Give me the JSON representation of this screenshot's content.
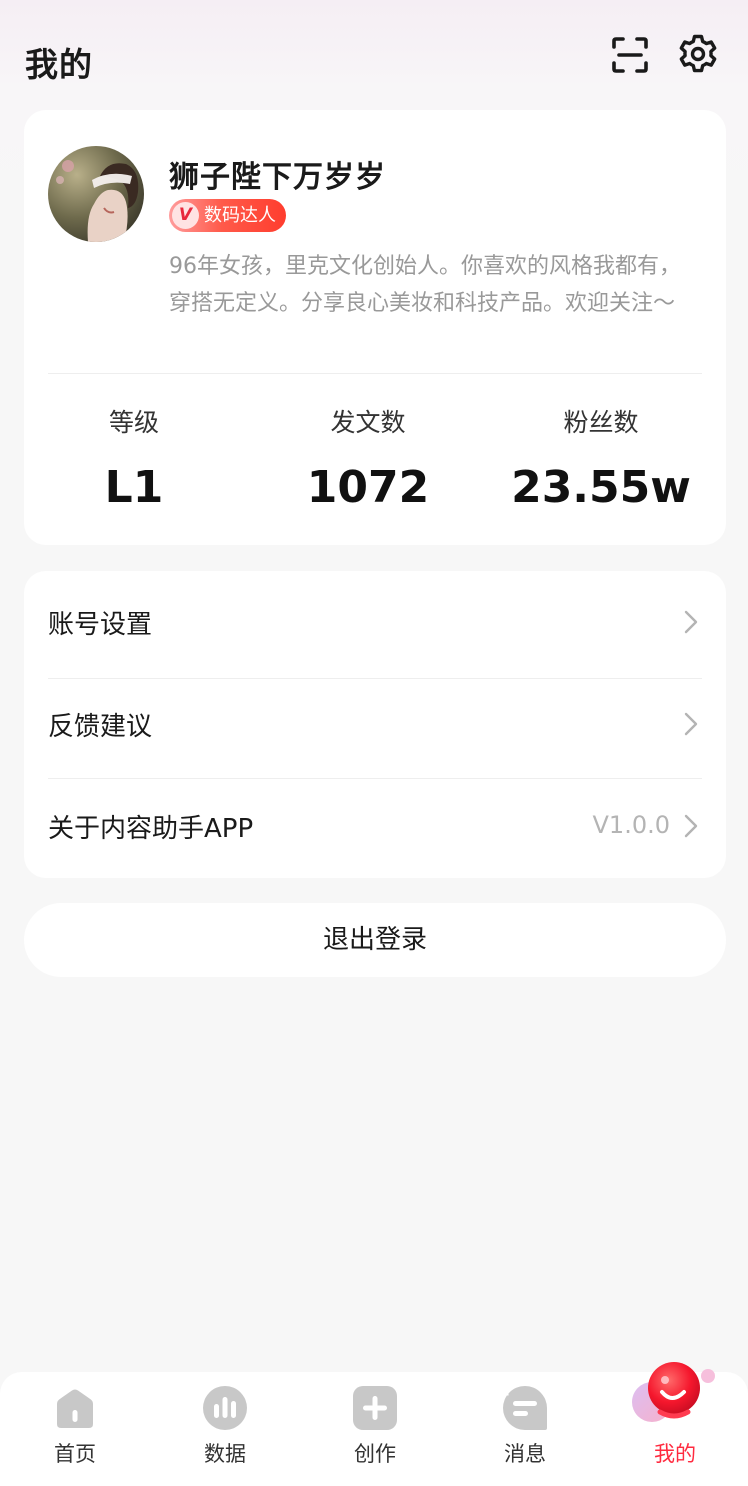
{
  "header": {
    "title": "我的"
  },
  "profile": {
    "username": "狮子陛下万岁岁",
    "badge": {
      "icon_text": "V",
      "label": "数码达人"
    },
    "bio": "96年女孩，里克文化创始人。你喜欢的风格我都有，穿搭无定义。分享良心美妆和科技产品。欢迎关注～",
    "stats": [
      {
        "label": "等级",
        "value": "L1"
      },
      {
        "label": "发文数",
        "value": "1072"
      },
      {
        "label": "粉丝数",
        "value": "23.55w"
      }
    ]
  },
  "menu": {
    "items": [
      {
        "label": "账号设置",
        "value": ""
      },
      {
        "label": "反馈建议",
        "value": ""
      },
      {
        "label": "关于内容助手APP",
        "value": "V1.0.0"
      }
    ]
  },
  "logout": {
    "label": "退出登录"
  },
  "bottom_nav": {
    "items": [
      {
        "label": "首页",
        "icon": "home-icon",
        "active": false
      },
      {
        "label": "数据",
        "icon": "data-icon",
        "active": false
      },
      {
        "label": "创作",
        "icon": "create-icon",
        "active": false
      },
      {
        "label": "消息",
        "icon": "message-icon",
        "active": false
      },
      {
        "label": "我的",
        "icon": "profile-icon",
        "active": true
      }
    ]
  },
  "colors": {
    "accent": "#ff2a3f",
    "inactive_icon": "#c8c8c8",
    "muted_text": "#999999"
  }
}
